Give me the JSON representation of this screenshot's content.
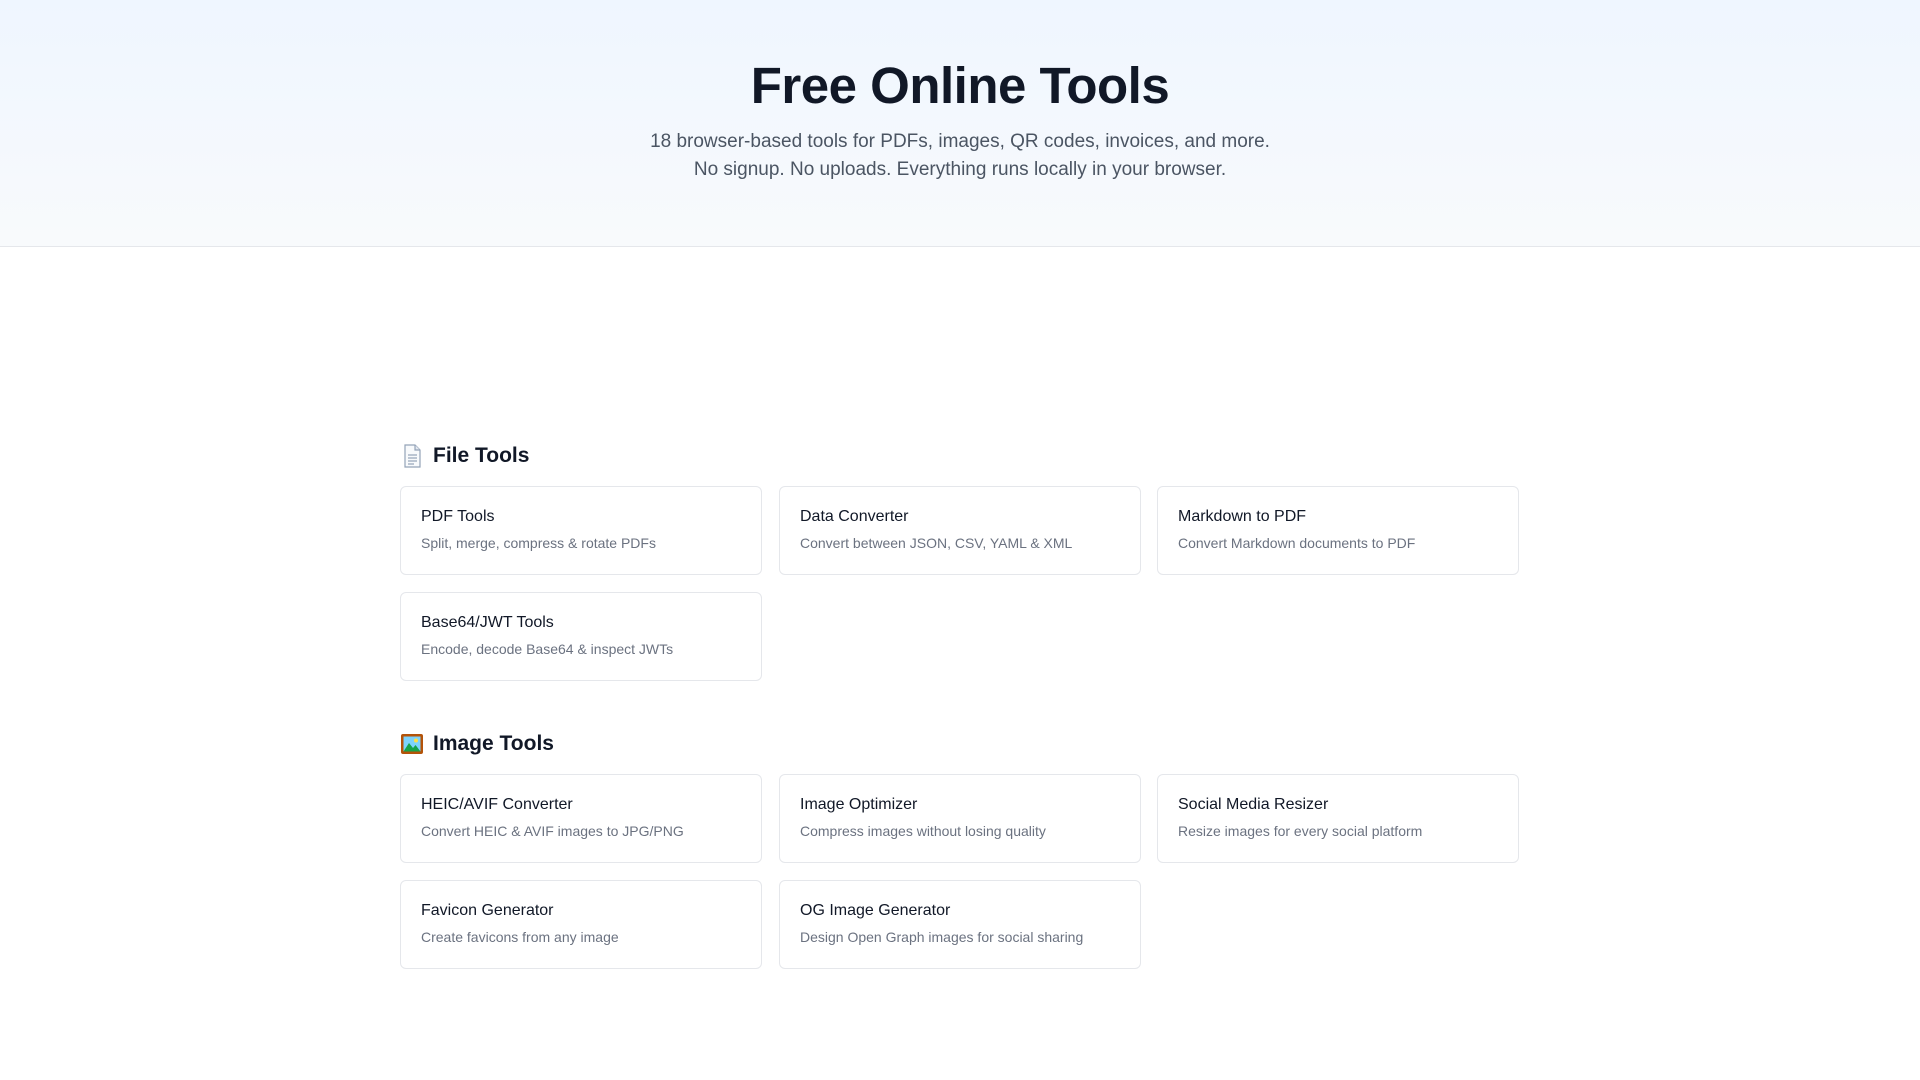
{
  "hero": {
    "title": "Free Online Tools",
    "subtitle": "18 browser-based tools for PDFs, images, QR codes, invoices, and more. No signup. No uploads. Everything runs locally in your browser."
  },
  "sections": [
    {
      "icon": "document-icon",
      "title": "File Tools",
      "tools": [
        {
          "name": "PDF Tools",
          "desc": "Split, merge, compress & rotate PDFs"
        },
        {
          "name": "Data Converter",
          "desc": "Convert between JSON, CSV, YAML & XML"
        },
        {
          "name": "Markdown to PDF",
          "desc": "Convert Markdown documents to PDF"
        },
        {
          "name": "Base64/JWT Tools",
          "desc": "Encode, decode Base64 & inspect JWTs"
        }
      ]
    },
    {
      "icon": "framed-picture-icon",
      "title": "Image Tools",
      "tools": [
        {
          "name": "HEIC/AVIF Converter",
          "desc": "Convert HEIC & AVIF images to JPG/PNG"
        },
        {
          "name": "Image Optimizer",
          "desc": "Compress images without losing quality"
        },
        {
          "name": "Social Media Resizer",
          "desc": "Resize images for every social platform"
        },
        {
          "name": "Favicon Generator",
          "desc": "Create favicons from any image"
        },
        {
          "name": "OG Image Generator",
          "desc": "Design Open Graph images for social sharing"
        }
      ]
    }
  ]
}
